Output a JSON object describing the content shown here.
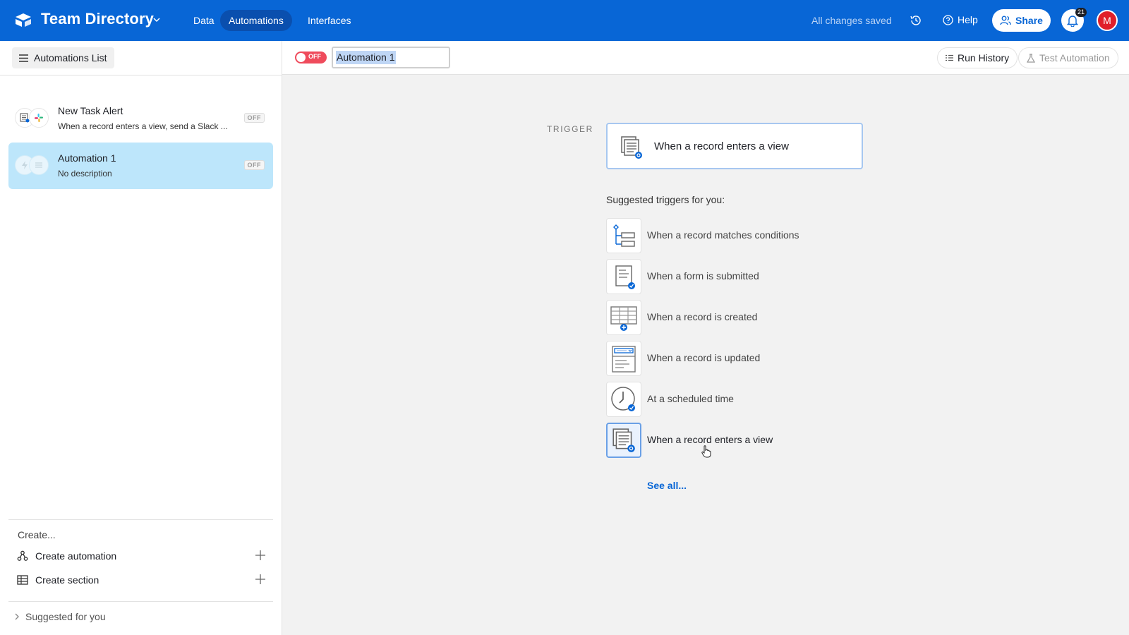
{
  "app": {
    "base_name": "Team Directory",
    "nav_tabs": [
      {
        "label": "Data"
      },
      {
        "label": "Automations"
      },
      {
        "label": "Interfaces"
      }
    ],
    "save_status": "All changes saved",
    "help_label": "Help",
    "share_label": "Share",
    "notification_count": "21",
    "avatar_initial": "M",
    "brand_color": "#0866d6"
  },
  "sidebar": {
    "list_toggle_label": "Automations List",
    "automations": [
      {
        "name": "New Task Alert",
        "description": "When a record enters a view, send a Slack ...",
        "status": "OFF"
      },
      {
        "name": "Automation 1",
        "description": "No description",
        "status": "OFF",
        "selected": true
      }
    ],
    "create_label": "Create...",
    "create_automation_label": "Create automation",
    "create_section_label": "Create section",
    "suggested_label": "Suggested for you"
  },
  "toolbar": {
    "toggle_label": "OFF",
    "automation_name": "Automation 1",
    "run_history_label": "Run History",
    "test_automation_label": "Test Automation"
  },
  "main": {
    "trigger_label": "TRIGGER",
    "selected_trigger": "When a record enters a view",
    "suggested_title": "Suggested triggers for you:",
    "suggested_triggers": [
      {
        "label": "When a record matches conditions",
        "icon": "conditions-icon"
      },
      {
        "label": "When a form is submitted",
        "icon": "form-icon"
      },
      {
        "label": "When a record is created",
        "icon": "record-created-icon"
      },
      {
        "label": "When a record is updated",
        "icon": "record-updated-icon"
      },
      {
        "label": "At a scheduled time",
        "icon": "clock-icon"
      },
      {
        "label": "When a record enters a view",
        "icon": "view-icon"
      }
    ],
    "see_all_label": "See all..."
  }
}
